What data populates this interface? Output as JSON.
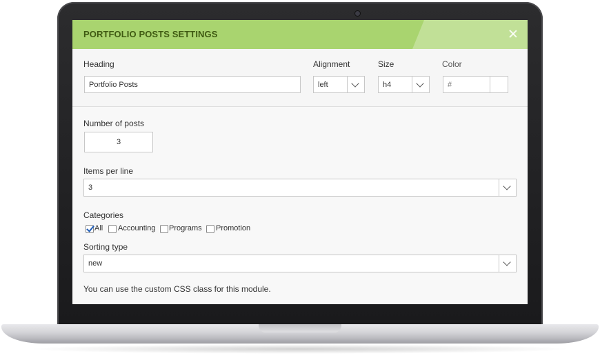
{
  "modal": {
    "title": "PORTFOLIO POSTS SETTINGS"
  },
  "heading": {
    "label": "Heading",
    "value": "Portfolio Posts"
  },
  "alignment": {
    "label": "Alignment",
    "value": "left"
  },
  "size": {
    "label": "Size",
    "value": "h4"
  },
  "color": {
    "label": "Color",
    "placeholder": "#"
  },
  "number_of_posts": {
    "label": "Number of posts",
    "value": "3"
  },
  "items_per_line": {
    "label": "Items per line",
    "value": "3"
  },
  "categories": {
    "label": "Categories",
    "options": [
      {
        "label": "All",
        "checked": true
      },
      {
        "label": "Accounting",
        "checked": false
      },
      {
        "label": "Programs",
        "checked": false
      },
      {
        "label": "Promotion",
        "checked": false
      }
    ]
  },
  "sorting_type": {
    "label": "Sorting type",
    "value": "new"
  },
  "help_text": "You can use the custom CSS class for this module.",
  "colors": {
    "header_bg": "#a9d46f",
    "title_text": "#3f5a12",
    "check": "#1f5db8"
  }
}
